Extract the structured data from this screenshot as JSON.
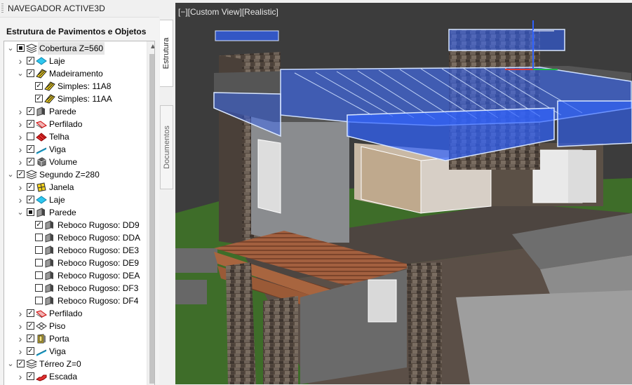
{
  "navigator": {
    "title": "NAVEGADOR ACTIVE3D",
    "tree_heading": "Estrutura de Pavimentos e Objetos",
    "tree": [
      {
        "label": "Cobertura Z=560",
        "level": 0,
        "expander": "open",
        "check": "partial",
        "icon": "floor-layers-icon",
        "selected": true
      },
      {
        "label": "Laje",
        "level": 1,
        "expander": "closed",
        "check": "checked",
        "icon": "slab-icon"
      },
      {
        "label": "Madeiramento",
        "level": 1,
        "expander": "open",
        "check": "checked",
        "icon": "timber-icon"
      },
      {
        "label": "Simples: 11A8",
        "level": 2,
        "expander": "none",
        "check": "checked",
        "icon": "timber-icon"
      },
      {
        "label": "Simples: 11AA",
        "level": 2,
        "expander": "none",
        "check": "checked",
        "icon": "timber-icon"
      },
      {
        "label": "Parede",
        "level": 1,
        "expander": "closed",
        "check": "checked",
        "icon": "wall-icon"
      },
      {
        "label": "Perfilado",
        "level": 1,
        "expander": "closed",
        "check": "checked",
        "icon": "profile-icon"
      },
      {
        "label": "Telha",
        "level": 1,
        "expander": "closed",
        "check": "unchecked",
        "icon": "roof-tile-icon"
      },
      {
        "label": "Viga",
        "level": 1,
        "expander": "closed",
        "check": "checked",
        "icon": "beam-icon"
      },
      {
        "label": "Volume",
        "level": 1,
        "expander": "closed",
        "check": "checked",
        "icon": "volume-icon"
      },
      {
        "label": "Segundo Z=280",
        "level": 0,
        "expander": "open",
        "check": "checked",
        "icon": "floor-layers-icon"
      },
      {
        "label": "Janela",
        "level": 1,
        "expander": "closed",
        "check": "checked",
        "icon": "window-icon"
      },
      {
        "label": "Laje",
        "level": 1,
        "expander": "closed",
        "check": "checked",
        "icon": "slab-icon"
      },
      {
        "label": "Parede",
        "level": 1,
        "expander": "open",
        "check": "partial",
        "icon": "wall-icon"
      },
      {
        "label": "Reboco Rugoso: DD9",
        "level": 2,
        "expander": "none",
        "check": "checked",
        "icon": "wall-icon"
      },
      {
        "label": "Reboco Rugoso: DDA",
        "level": 2,
        "expander": "none",
        "check": "unchecked",
        "icon": "wall-icon"
      },
      {
        "label": "Reboco Rugoso: DE3",
        "level": 2,
        "expander": "none",
        "check": "unchecked",
        "icon": "wall-icon"
      },
      {
        "label": "Reboco Rugoso: DE9",
        "level": 2,
        "expander": "none",
        "check": "unchecked",
        "icon": "wall-icon"
      },
      {
        "label": "Reboco Rugoso: DEA",
        "level": 2,
        "expander": "none",
        "check": "unchecked",
        "icon": "wall-icon"
      },
      {
        "label": "Reboco Rugoso: DF3",
        "level": 2,
        "expander": "none",
        "check": "unchecked",
        "icon": "wall-icon"
      },
      {
        "label": "Reboco Rugoso: DF4",
        "level": 2,
        "expander": "none",
        "check": "unchecked",
        "icon": "wall-icon"
      },
      {
        "label": "Perfilado",
        "level": 1,
        "expander": "closed",
        "check": "checked",
        "icon": "profile-icon"
      },
      {
        "label": "Piso",
        "level": 1,
        "expander": "closed",
        "check": "checked",
        "icon": "floor-tile-icon"
      },
      {
        "label": "Porta",
        "level": 1,
        "expander": "closed",
        "check": "checked",
        "icon": "door-icon"
      },
      {
        "label": "Viga",
        "level": 1,
        "expander": "closed",
        "check": "checked",
        "icon": "beam-icon"
      },
      {
        "label": "Térreo Z=0",
        "level": 0,
        "expander": "open",
        "check": "checked",
        "icon": "floor-layers-icon"
      },
      {
        "label": "Escada",
        "level": 1,
        "expander": "closed",
        "check": "checked",
        "icon": "stair-icon"
      }
    ]
  },
  "tabs": {
    "estrutura": "Estrutura",
    "documentos": "Documentos"
  },
  "viewport": {
    "label": "[−][Custom View][Realistic]"
  },
  "colors": {
    "selection_blue": "#2f62ff",
    "sky": "#3b3b3b",
    "grass": "#3f6f2a",
    "stone": "#5a5048",
    "wood": "#a9684a"
  }
}
